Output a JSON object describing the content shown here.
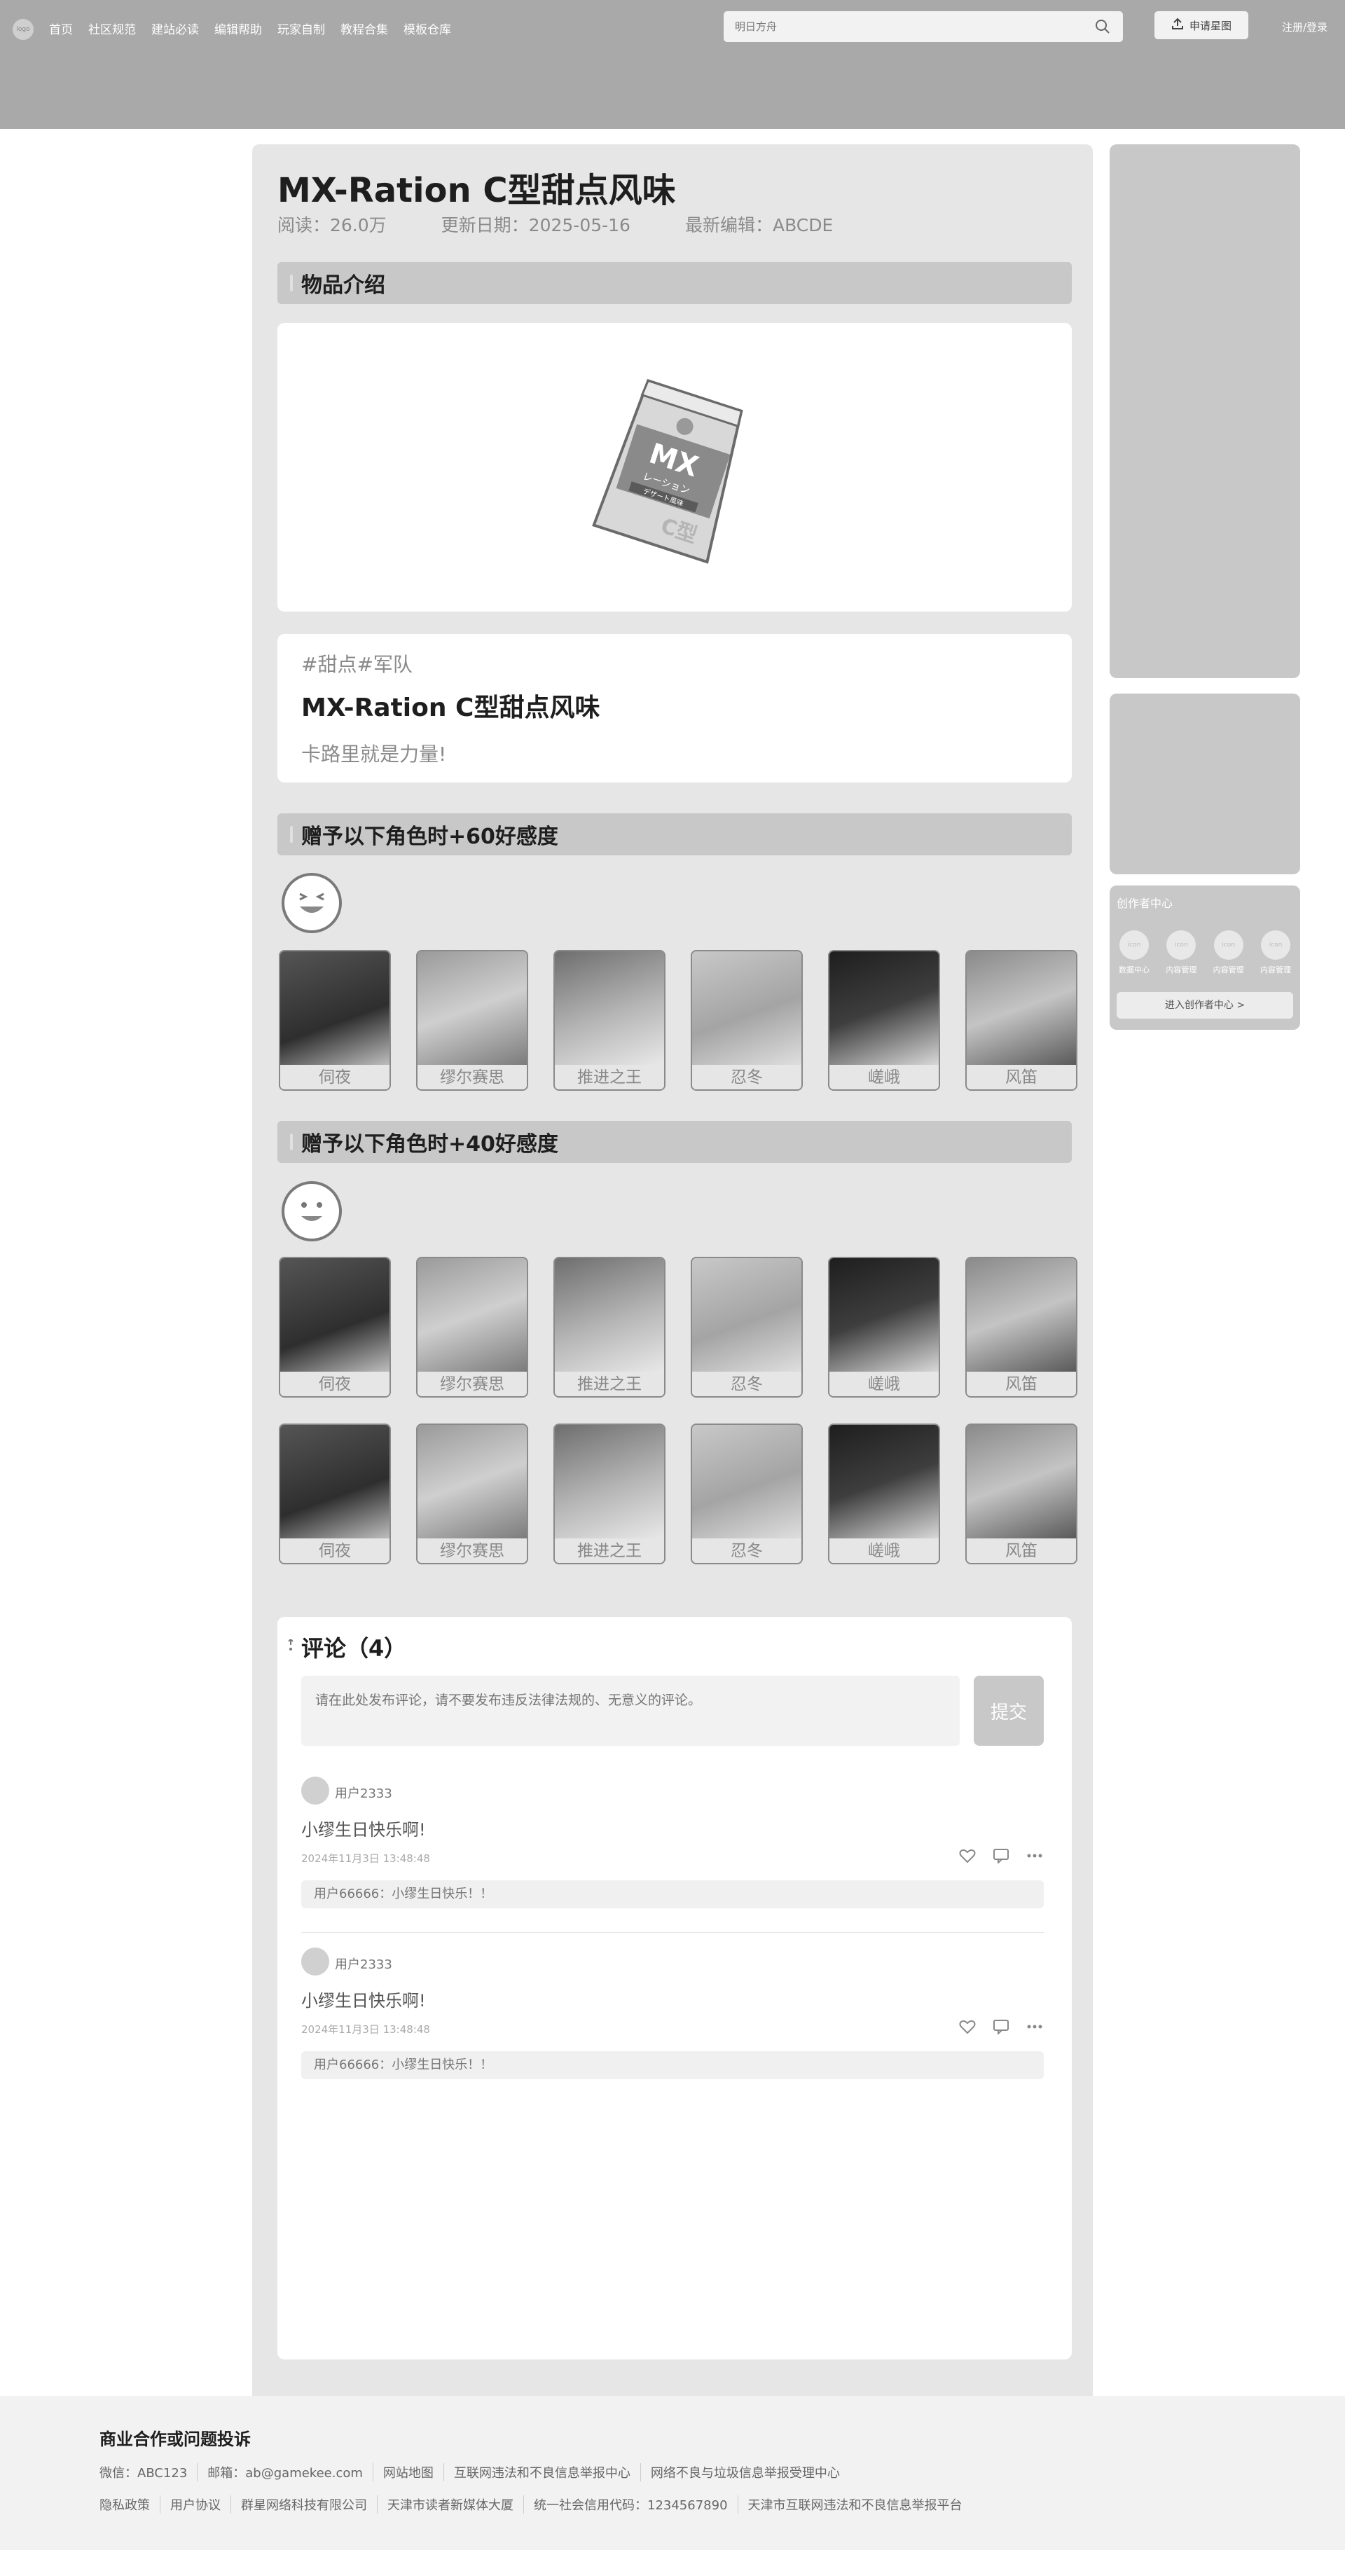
{
  "nav": {
    "logo_text": "logo",
    "items": [
      "首页",
      "社区规范",
      "建站必读",
      "编辑帮助",
      "玩家自制",
      "教程合集",
      "模板仓库"
    ],
    "search_placeholder": "明日方舟",
    "apply_label": "申请星图",
    "login_label": "注册/登录"
  },
  "article": {
    "title": "MX-Ration C型甜点风味",
    "meta": {
      "reads": "阅读：26.0万",
      "updated": "更新日期：2025-05-16",
      "editor": "最新编辑：ABCDE"
    }
  },
  "sections": {
    "intro": "物品介绍",
    "favor60": "赠予以下角色时+60好感度",
    "favor40": "赠予以下角色时+40好感度"
  },
  "item": {
    "image_icon": "ration-pack-image",
    "pack_text": "MX",
    "pack_sub1": "レーション",
    "pack_sub2": "デザート風味",
    "pack_type": "C型",
    "tags": "#甜点#军队",
    "name": "MX-Ration C型甜点风味",
    "desc": "卡路里就是力量!"
  },
  "characters": [
    "伺夜",
    "缪尔赛思",
    "推进之王",
    "忍冬",
    "嵯峨",
    "风笛"
  ],
  "comments": {
    "title": "评论（4）",
    "input_placeholder": "请在此处发布评论，请不要发布违反法律法规的、无意义的评论。",
    "submit_label": "提交",
    "list": [
      {
        "user": "用户2333",
        "text": "小缪生日快乐啊!",
        "time": "2024年11月3日  13:48:48",
        "reply": "用户66666：小缪生日快乐！！"
      },
      {
        "user": "用户2333",
        "text": "小缪生日快乐啊!",
        "time": "2024年11月3日  13:48:48",
        "reply": "用户66666：小缪生日快乐！！"
      }
    ]
  },
  "creator": {
    "title": "创作者中心",
    "items": [
      {
        "icon": "icon",
        "label": "数据中心"
      },
      {
        "icon": "icon",
        "label": "内容管理"
      },
      {
        "icon": "icon",
        "label": "内容管理"
      },
      {
        "icon": "icon",
        "label": "内容管理"
      }
    ],
    "button": "进入创作者中心 >"
  },
  "footer": {
    "title": "商业合作或问题投诉",
    "line1": [
      "微信：ABC123",
      "邮箱：ab@gamekee.com",
      "网站地图",
      "互联网违法和不良信息举报中心",
      "网络不良与垃圾信息举报受理中心"
    ],
    "line2": [
      "隐私政策",
      "用户协议",
      "群星网络科技有限公司",
      "天津市读者新媒体大厦",
      "统一社会信用代码：1234567890",
      "天津市互联网违法和不良信息举报平台"
    ]
  }
}
